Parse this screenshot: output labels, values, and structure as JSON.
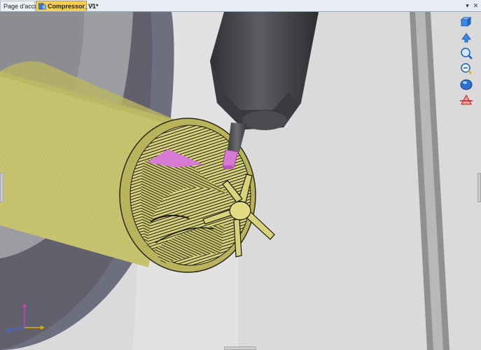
{
  "tabs": [
    {
      "label": "Page d'accueil",
      "active": false
    },
    {
      "label": "Compressor_V1*",
      "active": true
    }
  ],
  "window_controls": {
    "dropdown_icon": "chevron-down-icon",
    "close_icon": "close-icon"
  },
  "viewport": {
    "background_color": "#dcdcdc",
    "part_color": "#c8c470",
    "toolpath_color": "#1a1a10",
    "tool_holder_color": "#45474c",
    "cutter_color": "#d67ad6",
    "chuck_color": "#6d6f80"
  },
  "view_toolbar": {
    "icons": [
      "view-cube-icon",
      "pan-icon",
      "zoom-window-icon",
      "zoom-fit-icon",
      "shaded-view-icon",
      "section-view-icon"
    ]
  },
  "axis_triad": {
    "icon": "axis-triad-icon",
    "colors": {
      "x": "#e0b000",
      "y": "#3a6ad8",
      "z": "#c040c0"
    }
  }
}
